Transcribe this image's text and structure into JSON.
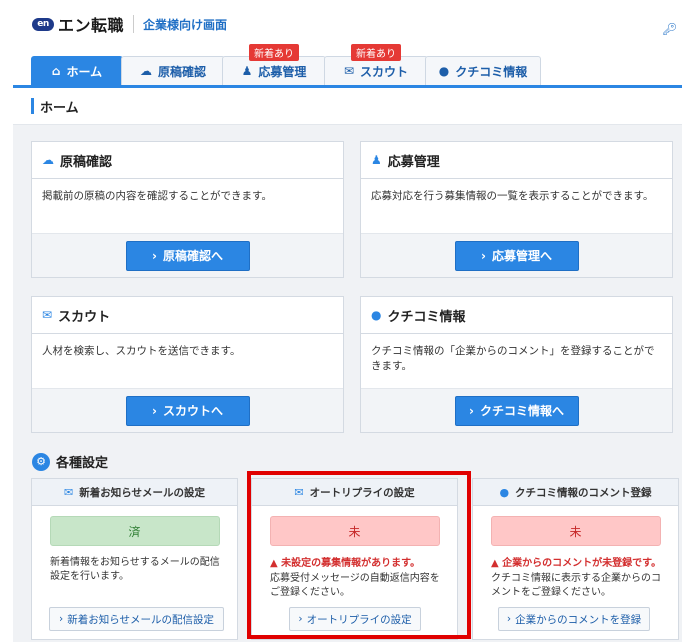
{
  "header": {
    "logo_mark": "en",
    "logo_text": "エン転職",
    "subtitle": "企業様向け画面"
  },
  "tabs": [
    {
      "label": "ホーム",
      "icon": "home-icon",
      "active": true
    },
    {
      "label": "原稿確認",
      "icon": "cloud-icon",
      "active": false
    },
    {
      "label": "応募管理",
      "icon": "users-icon",
      "active": false,
      "badge": "新着あり"
    },
    {
      "label": "スカウト",
      "icon": "mail-icon",
      "active": false,
      "badge": "新着あり"
    },
    {
      "label": "クチコミ情報",
      "icon": "chat-icon",
      "active": false
    }
  ],
  "page_title": "ホーム",
  "cards": [
    {
      "title": "原稿確認",
      "icon": "cloud-icon",
      "desc": "掲載前の原稿の内容を確認することができます。",
      "button": "原稿確認へ"
    },
    {
      "title": "応募管理",
      "icon": "users-icon",
      "desc": "応募対応を行う募集情報の一覧を表示することができます。",
      "button": "応募管理へ"
    },
    {
      "title": "スカウト",
      "icon": "mail-icon",
      "desc": "人材を検索し、スカウトを送信できます。",
      "button": "スカウトへ"
    },
    {
      "title": "クチコミ情報",
      "icon": "chat-icon",
      "desc": "クチコミ情報の「企業からのコメント」を登録することができます。",
      "button": "クチコミ情報へ"
    }
  ],
  "settings": {
    "title": "各種設定",
    "items": [
      {
        "title": "新着お知らせメールの設定",
        "icon": "mail-icon",
        "status": "済",
        "status_kind": "done",
        "warning": "",
        "desc": "新着情報をお知らせするメールの配信設定を行います。",
        "button": "新着お知らせメールの配信設定"
      },
      {
        "title": "オートリプライの設定",
        "icon": "mail-icon",
        "status": "未",
        "status_kind": "notyet",
        "warning": "未設定の募集情報があります。",
        "desc": "応募受付メッセージの自動返信内容をご登録ください。",
        "button": "オートリプライの設定"
      },
      {
        "title": "クチコミ情報のコメント登録",
        "icon": "chat-icon",
        "status": "未",
        "status_kind": "notyet",
        "warning": "企業からのコメントが未登録です。",
        "desc": "クチコミ情報に表示する企業からのコメントをご登録ください。",
        "button": "企業からのコメントを登録"
      }
    ]
  },
  "colors": {
    "accent": "#2b86e3",
    "badge": "#e53935",
    "highlight": "#e00000"
  }
}
